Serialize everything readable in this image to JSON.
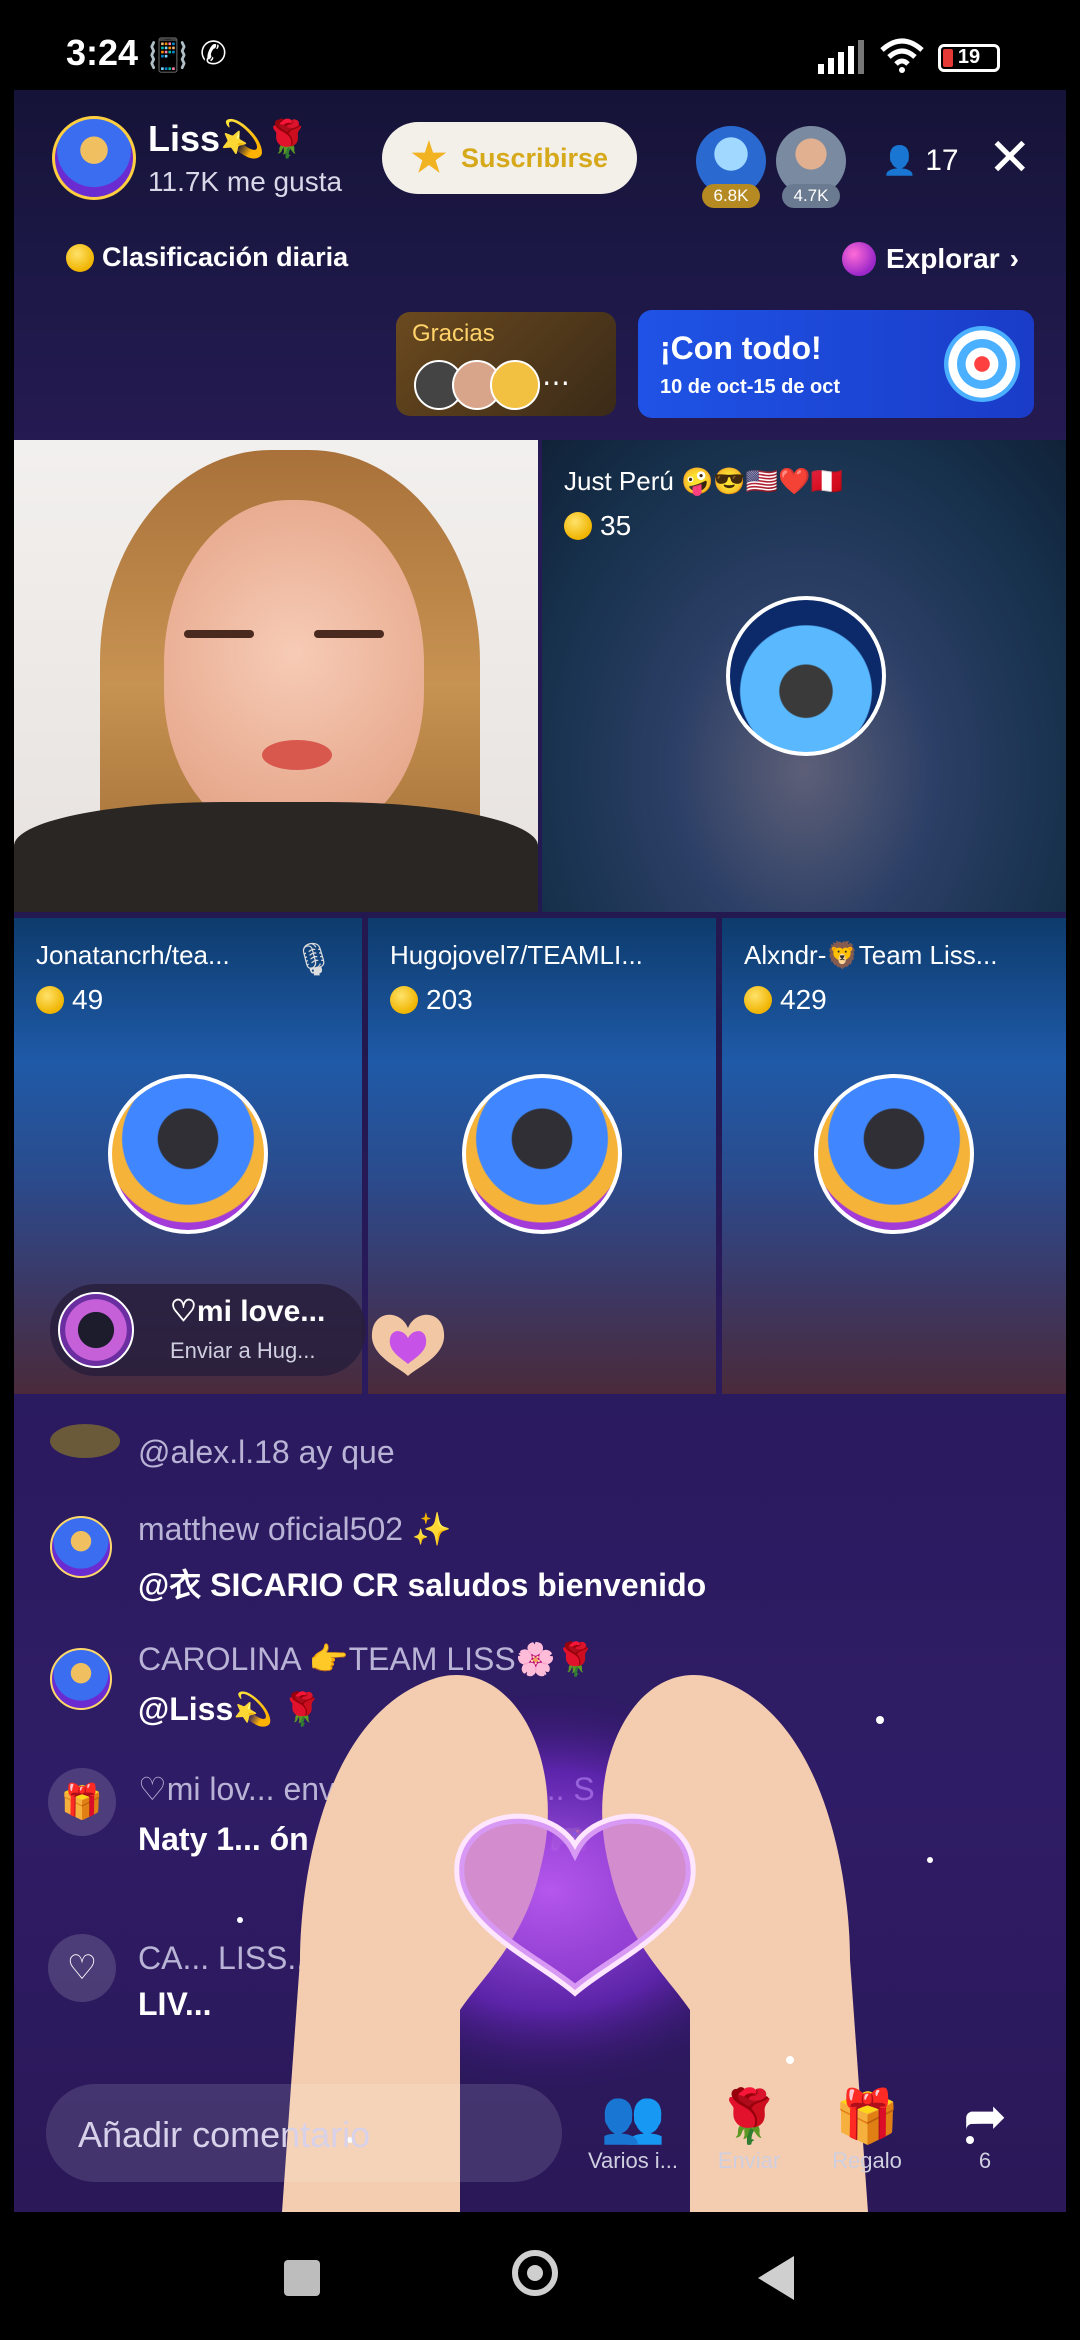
{
  "status_bar": {
    "time": "3:24",
    "battery": "19"
  },
  "host": {
    "name": "Liss💫🌹",
    "likes": "11.7K me gusta",
    "subscribe_label": "Suscribirse"
  },
  "top_viewers": [
    {
      "badge": "6.8K"
    },
    {
      "badge": "4.7K"
    }
  ],
  "viewer_count": "17",
  "daily_ranking": "Clasificación diaria",
  "explore": "Explorar",
  "gracias": {
    "label": "Gracias"
  },
  "promo": {
    "title": "¡Con todo!",
    "dates": "10 de oct-15 de oct"
  },
  "guests": [
    {
      "name": "Just Perú 🤪😎🇺🇸❤️🇵🇪",
      "coins": "35"
    },
    {
      "name": "Jonatancrh/tea...",
      "coins": "49"
    },
    {
      "name": "Hugojovel7/TEAMLI...",
      "coins": "203"
    },
    {
      "name": "Alxndr-🦁Team Liss...",
      "coins": "429"
    }
  ],
  "gift_notice": {
    "title": "♡mi love...",
    "subtitle": "Enviar a Hug..."
  },
  "comments": [
    {
      "name": "",
      "text": "@alex.l.18 ay que"
    },
    {
      "name": "matthew oficial502 ✨",
      "text": "@衣 SICARIO CR saludos bienvenido"
    },
    {
      "name": "CAROLINA 👉TEAM LISS🌸🌹",
      "text": "@Liss💫 🌹"
    },
    {
      "name": "♡mi lov... envió Hugojovel7/... S 🌹 🌹",
      "text": "Naty 1... ón con las manos 🎮"
    },
    {
      "name": "CA... LISS... ... sta al",
      "text": "LIV..."
    }
  ],
  "comment_placeholder": "Añadir comentario",
  "actions": [
    {
      "label": "Varios i...",
      "icon": "multi-guest-icon"
    },
    {
      "label": "Enviar",
      "icon": "rose-icon"
    },
    {
      "label": "Regalo",
      "icon": "gift-icon"
    },
    {
      "label": "6",
      "icon": "share-icon"
    }
  ]
}
